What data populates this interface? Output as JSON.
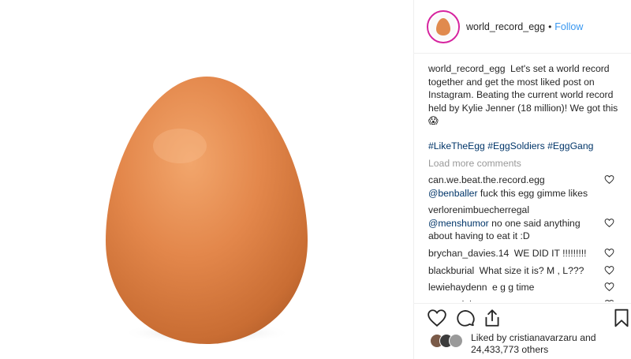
{
  "post": {
    "image": {
      "subject-icon": "egg"
    },
    "header": {
      "username": "world_record_egg",
      "separator": "•",
      "follow_label": "Follow"
    },
    "caption": {
      "username": "world_record_egg",
      "text": "Let's set a world record together and get the most liked post on Instagram. Beating the current world record held by Kylie Jenner (18 million)! We got this 😱",
      "hashtags": [
        "#LikeTheEgg",
        "#EggSoldiers",
        "#EggGang"
      ]
    },
    "load_more_label": "Load more comments",
    "comments": [
      {
        "username": "can.we.beat.the.record.egg",
        "mention": "@benballer",
        "text": "fuck this egg gimme likes"
      },
      {
        "username": "verlorenimbuecherregal",
        "mention": "@menshumor",
        "text": "no one said anything about having to eat it :D"
      },
      {
        "username": "brychan_davies.14",
        "mention": "",
        "text": "WE DID IT !!!!!!!!!"
      },
      {
        "username": "blackburial",
        "mention": "",
        "text": "What size it is? M , L???"
      },
      {
        "username": "lewiehaydenn",
        "mention": "",
        "text": "e g g time"
      },
      {
        "username": "anastasiakvon",
        "mention": "",
        "text": "чо"
      }
    ],
    "actions": {
      "like": "heart-icon",
      "comment": "comment-icon",
      "share": "share-icon",
      "save": "bookmark-icon"
    },
    "likes": {
      "liked_by_prefix": "Liked by",
      "liked_by_user": "cristianavarzaru",
      "and": "and",
      "others_count": "24,433,773",
      "others_label": "others"
    },
    "colors": {
      "link_blue": "#3897f0",
      "hashtag_blue": "#003569",
      "muted_gray": "#999999",
      "egg": "#e08a4e",
      "avatar_ring": "#d6249f"
    }
  }
}
